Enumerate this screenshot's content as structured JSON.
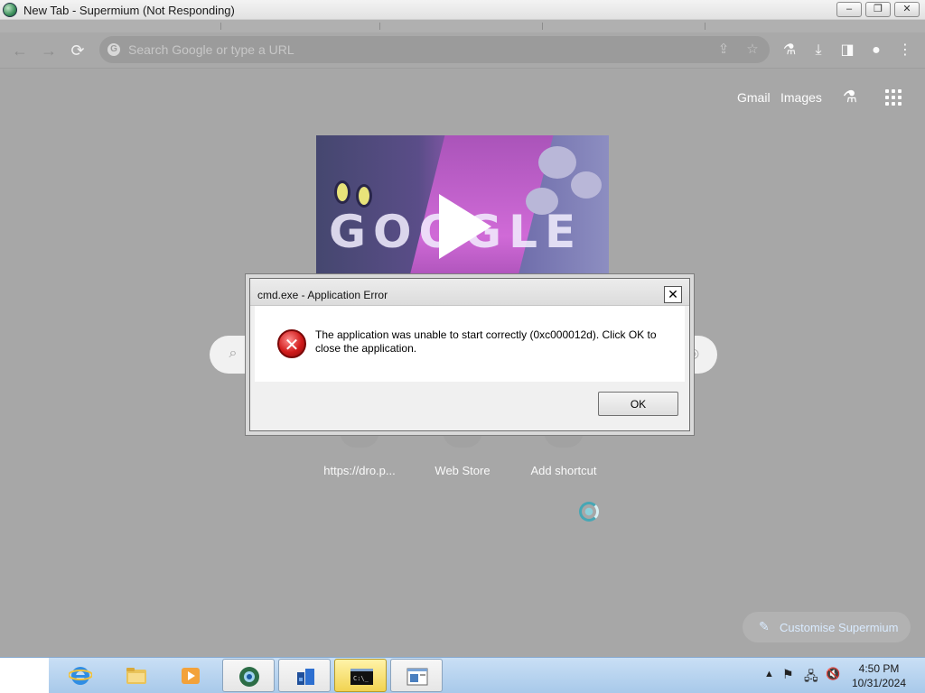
{
  "window": {
    "title": "New Tab - Supermium (Not Responding)",
    "minimize_label": "▭",
    "maximize_label": "⧉",
    "close_label": "✕"
  },
  "omnibox": {
    "placeholder": "Search Google or type a URL"
  },
  "ntp": {
    "gmail": "Gmail",
    "images": "Images",
    "doodle_text": "GOOGLE",
    "shortcuts": [
      {
        "label": "https://dro.p..."
      },
      {
        "label": "Web Store"
      },
      {
        "label": "Add shortcut"
      }
    ],
    "customise": "Customise Supermium"
  },
  "dialog": {
    "title": "cmd.exe - Application Error",
    "message": "The application was unable to start correctly (0xc000012d). Click OK to close the application.",
    "ok_label": "OK",
    "close_glyph": "✕"
  },
  "taskbar": {
    "time": "4:50 PM",
    "date": "10/31/2024",
    "apps": [
      "internet-explorer",
      "file-explorer",
      "media-player",
      "supermium",
      "cmd-prompt-window",
      "command-prompt",
      "open-window"
    ]
  },
  "colors": {
    "error_red": "#d11b1b",
    "taskbar": "#b7d3ef",
    "dimmed_overlay": "#a7a7a7"
  }
}
